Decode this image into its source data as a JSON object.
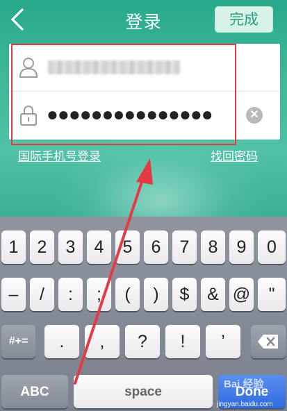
{
  "navbar": {
    "title": "登录",
    "done_label": "完成",
    "back_icon": "chevron-left-icon"
  },
  "form": {
    "username_icon": "user-icon",
    "password_icon": "lock-icon",
    "password_value": "●●●●●●●●●●●●●●●",
    "clear_icon": "clear-circle-icon",
    "clear_glyph": "✕"
  },
  "links": {
    "intl_login": "国际手机号登录",
    "forgot_password": "找回密码"
  },
  "keyboard": {
    "row1": [
      "1",
      "2",
      "3",
      "4",
      "5",
      "6",
      "7",
      "8",
      "9",
      "0"
    ],
    "row2": [
      "–",
      "/",
      ":",
      ";",
      "(",
      ")",
      "$",
      "&",
      "@",
      "\""
    ],
    "row3": [
      "#+=",
      ".",
      ",",
      "?",
      "!",
      "’"
    ],
    "row4": {
      "abc": "ABC",
      "space": "space",
      "done": "Done"
    }
  },
  "watermark": {
    "logo": "Bai 经验",
    "url": "jingyan.baidu.com"
  },
  "colors": {
    "accent": "#27a98a",
    "highlight": "#e43a45"
  }
}
